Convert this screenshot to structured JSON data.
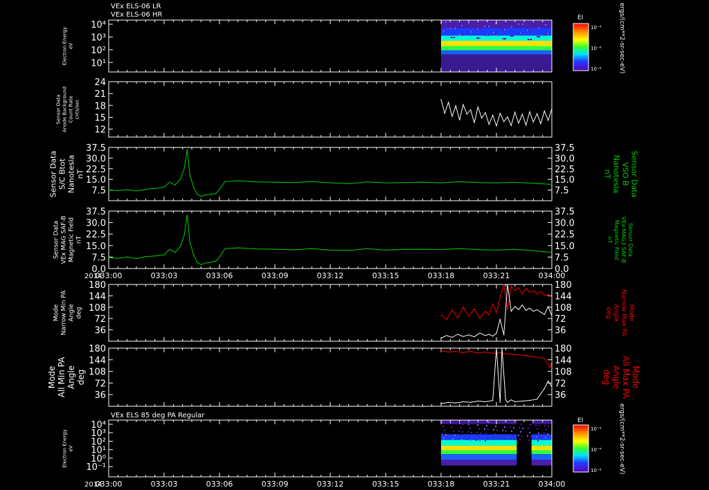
{
  "titles": {
    "top_line1": "VEx ELS-06 LR",
    "top_line2": "VEx ELS-06 HR",
    "bottom": "VEx ELS 85 deg PA Regular"
  },
  "colors": {
    "background": "#000000",
    "axis": "#ffffff",
    "green": "#00d000",
    "red": "#ff0000",
    "white_trace": "#ffffff"
  },
  "x_axis": {
    "year_label": "2014",
    "ticks": [
      "033:00",
      "033:03",
      "033:06",
      "033:09",
      "033:12",
      "033:15",
      "033:18",
      "033:21",
      "034:00"
    ],
    "range_minutes": [
      0,
      24
    ]
  },
  "colorbars": [
    {
      "label": "EI",
      "ticks": [
        "10⁻⁴",
        "10⁻⁶",
        "10⁻⁸"
      ],
      "unit": "ergs/(cm**2-sr-sec-eV)"
    },
    {
      "label": "EI",
      "ticks": [
        "10⁻⁴",
        "10⁻⁶",
        "10⁻⁸"
      ],
      "unit": "ergs/(cm**2-sr-sec-eV)"
    }
  ],
  "chart_data": [
    {
      "id": "panel1",
      "type": "heatmap",
      "ylabel_left": [
        "Electron Energy",
        "eV"
      ],
      "y_scale": "log",
      "yticks_left": [
        "10⁴",
        "10³",
        "10²",
        "10¹"
      ],
      "data_start_minute": 18.0,
      "energy_bands": [
        {
          "y_frac": [
            0.85,
            1.0
          ],
          "color": "#4b1ea8"
        },
        {
          "y_frac": [
            0.7,
            0.85
          ],
          "color": "#1a3cff"
        },
        {
          "y_frac": [
            0.6,
            0.7
          ],
          "color": "#00ffd0"
        },
        {
          "y_frac": [
            0.5,
            0.6
          ],
          "color": "#ffe000"
        },
        {
          "y_frac": [
            0.42,
            0.5
          ],
          "color": "#30ff40"
        },
        {
          "y_frac": [
            0.34,
            0.42
          ],
          "color": "#1a60ff"
        },
        {
          "y_frac": [
            0.0,
            0.34
          ],
          "color": "#3a1a90"
        }
      ]
    },
    {
      "id": "panel2",
      "type": "line",
      "ylabel_left": [
        "Sensor Data",
        "Anode Background",
        "Count Rate",
        "cnts/sec"
      ],
      "ylim": [
        10,
        24
      ],
      "yticks_left": [
        "24",
        "21",
        "18",
        "15",
        "12"
      ],
      "series": [
        {
          "color": "#ffffff",
          "x": [
            18.0,
            18.2,
            18.4,
            18.6,
            18.8,
            19.0,
            19.2,
            19.4,
            19.6,
            19.8,
            20.0,
            20.2,
            20.4,
            20.6,
            20.8,
            21.0,
            21.2,
            21.4,
            21.6,
            21.8,
            22.0,
            22.2,
            22.4,
            22.6,
            22.8,
            23.0,
            23.2,
            23.4,
            23.6,
            23.8,
            24.0
          ],
          "y": [
            19.5,
            16.0,
            18.8,
            15.2,
            17.9,
            14.3,
            18.2,
            15.8,
            16.9,
            13.6,
            17.6,
            14.8,
            16.2,
            13.2,
            15.5,
            12.8,
            16.0,
            13.9,
            15.1,
            12.9,
            16.3,
            13.5,
            15.8,
            13.0,
            16.4,
            13.8,
            15.9,
            13.4,
            16.6,
            14.2,
            17.2
          ]
        }
      ]
    },
    {
      "id": "panel3",
      "type": "line",
      "ylabel_left": [
        "Sensor Data",
        "S/C Btot",
        "Nanotesla",
        "nT"
      ],
      "ylabel_right": [
        "Sensor Data",
        "VSO B",
        "Nanotesla",
        "nT"
      ],
      "ylim": [
        0,
        37.5
      ],
      "yticks": [
        "37.5",
        "30.0",
        "22.5",
        "15.0",
        "7.5"
      ],
      "series": [
        {
          "color": "#00d000",
          "x": [
            0,
            0.5,
            1,
            1.5,
            2,
            2.5,
            3,
            3.3,
            3.6,
            3.9,
            4.1,
            4.25,
            4.4,
            4.6,
            4.8,
            5.0,
            5.2,
            5.5,
            5.8,
            6.0,
            6.3,
            7,
            8,
            9,
            10,
            11,
            12,
            13,
            14,
            15,
            16,
            17,
            18,
            19,
            20,
            21,
            22,
            23,
            24
          ],
          "y": [
            7.5,
            7.0,
            7.8,
            6.8,
            8.0,
            8.6,
            9.5,
            13.0,
            11.0,
            15.5,
            23.0,
            36.0,
            18.0,
            9.5,
            4.5,
            3.0,
            4.0,
            4.5,
            5.0,
            8.0,
            13.5,
            14.0,
            13.2,
            13.0,
            12.8,
            13.5,
            12.6,
            12.0,
            13.2,
            12.5,
            12.8,
            13.0,
            12.6,
            13.4,
            12.8,
            12.5,
            13.0,
            12.2,
            11.5
          ]
        }
      ]
    },
    {
      "id": "panel4",
      "type": "line",
      "ylabel_left": [
        "Sensor Data",
        "VEx MAG SAF-B",
        "Magnetic Field",
        "nT"
      ],
      "ylabel_right": [
        "Sensor Data",
        "VEx MAG3 SAF-B",
        "Magnetic Field",
        "nT"
      ],
      "ylim": [
        0,
        37.5
      ],
      "yticks": [
        "37.5",
        "30.0",
        "22.5",
        "15.0",
        "7.5",
        "0.0"
      ],
      "series": [
        {
          "color": "#00d000",
          "x": [
            0,
            0.5,
            1,
            1.5,
            2,
            2.5,
            3,
            3.3,
            3.6,
            3.9,
            4.1,
            4.25,
            4.4,
            4.6,
            4.8,
            5.0,
            5.2,
            5.5,
            5.8,
            6.0,
            6.3,
            7,
            8,
            9,
            10,
            11,
            12,
            13,
            14,
            15,
            16,
            17,
            18,
            19,
            20,
            21,
            22,
            23,
            24
          ],
          "y": [
            7.2,
            6.6,
            7.6,
            6.5,
            7.8,
            8.2,
            9.0,
            12.5,
            10.5,
            14.8,
            22.0,
            35.0,
            17.0,
            9.0,
            4.0,
            2.5,
            3.5,
            4.0,
            4.8,
            7.5,
            13.0,
            13.5,
            12.8,
            12.6,
            12.2,
            13.0,
            12.0,
            11.8,
            12.9,
            12.0,
            12.5,
            12.6,
            12.4,
            13.0,
            12.4,
            12.0,
            12.6,
            11.6,
            10.5
          ]
        }
      ]
    },
    {
      "id": "panel5",
      "type": "line",
      "ylabel_left": [
        "Mode",
        "Narrow Min PA",
        "Angle",
        "deg"
      ],
      "ylabel_right": [
        "Mode",
        "Narrow Max PA",
        "Angle",
        "deg"
      ],
      "ylim": [
        0,
        180
      ],
      "yticks": [
        "180",
        "144",
        "108",
        "72",
        "36"
      ],
      "series": [
        {
          "color": "#ff0000",
          "x": [
            18.0,
            18.3,
            18.6,
            18.9,
            19.2,
            19.5,
            19.8,
            20.1,
            20.4,
            20.6,
            20.8,
            21.0,
            21.2,
            21.4,
            21.6,
            21.8,
            22.0,
            22.2,
            22.4,
            22.6,
            22.8,
            23.0,
            23.2,
            23.4,
            23.6,
            23.8,
            24.0
          ],
          "y": [
            85,
            68,
            100,
            74,
            108,
            80,
            102,
            72,
            95,
            84,
            118,
            90,
            140,
            180,
            100,
            175,
            160,
            170,
            150,
            168,
            155,
            160,
            150,
            158,
            145,
            148,
            138
          ]
        },
        {
          "color": "#ffffff",
          "x": [
            18.0,
            18.3,
            18.6,
            18.9,
            19.2,
            19.5,
            19.8,
            20.1,
            20.4,
            20.6,
            20.8,
            21.0,
            21.2,
            21.4,
            21.6,
            21.8,
            22.0,
            22.2,
            22.4,
            22.6,
            22.8,
            23.0,
            23.2,
            23.4,
            23.6,
            23.8,
            24.0
          ],
          "y": [
            10,
            18,
            12,
            22,
            15,
            20,
            14,
            26,
            18,
            22,
            16,
            25,
            70,
            20,
            180,
            95,
            110,
            100,
            115,
            98,
            105,
            95,
            100,
            92,
            85,
            110,
            80
          ]
        }
      ]
    },
    {
      "id": "panel6",
      "type": "line",
      "ylabel_left": [
        "Mode",
        "All Min PA",
        "Angle",
        "deg"
      ],
      "ylabel_right": [
        "Mode",
        "All Max PA",
        "Angle",
        "deg"
      ],
      "ylim": [
        0,
        180
      ],
      "yticks": [
        "180",
        "144",
        "108",
        "72",
        "36"
      ],
      "series": [
        {
          "color": "#ff0000",
          "x": [
            18.0,
            18.4,
            18.8,
            19.2,
            19.6,
            20.0,
            20.4,
            20.8,
            21.2,
            21.6,
            22.0,
            22.4,
            22.8,
            23.2,
            23.6,
            23.9,
            24.0
          ],
          "y": [
            172,
            168,
            170,
            166,
            170,
            165,
            168,
            164,
            166,
            162,
            160,
            158,
            155,
            152,
            148,
            120,
            140
          ]
        },
        {
          "color": "#ffffff",
          "x": [
            18.0,
            18.4,
            18.8,
            19.2,
            19.6,
            20.0,
            20.4,
            20.8,
            21.0,
            21.2,
            21.3,
            21.5,
            21.6,
            21.8,
            22.0,
            22.4,
            22.8,
            23.2,
            23.6,
            23.8,
            24.0
          ],
          "y": [
            8,
            12,
            10,
            14,
            12,
            16,
            14,
            18,
            180,
            12,
            180,
            20,
            12,
            20,
            14,
            16,
            18,
            22,
            55,
            78,
            60
          ]
        }
      ]
    },
    {
      "id": "panel7",
      "type": "heatmap",
      "ylabel_left": [
        "Electron Energy",
        "eV"
      ],
      "y_scale": "log",
      "yticks_left": [
        "10⁴",
        "10³",
        "10²",
        "10¹",
        "10⁰",
        "10⁻¹"
      ],
      "data_start_minute": 18.0,
      "gaps_minutes": [
        [
          22.1,
          22.9
        ]
      ],
      "energy_bands": [
        {
          "y_frac": [
            0.93,
            1.0
          ],
          "color": "#3a1a90"
        },
        {
          "y_frac": [
            0.65,
            0.75
          ],
          "color": "#1a3cff"
        },
        {
          "y_frac": [
            0.55,
            0.65
          ],
          "color": "#00ffd0"
        },
        {
          "y_frac": [
            0.47,
            0.55
          ],
          "color": "#ffe000"
        },
        {
          "y_frac": [
            0.4,
            0.47
          ],
          "color": "#30ff40"
        },
        {
          "y_frac": [
            0.3,
            0.4
          ],
          "color": "#1a60ff"
        },
        {
          "y_frac": [
            0.2,
            0.3
          ],
          "color": "#4b1ea8"
        }
      ]
    }
  ]
}
